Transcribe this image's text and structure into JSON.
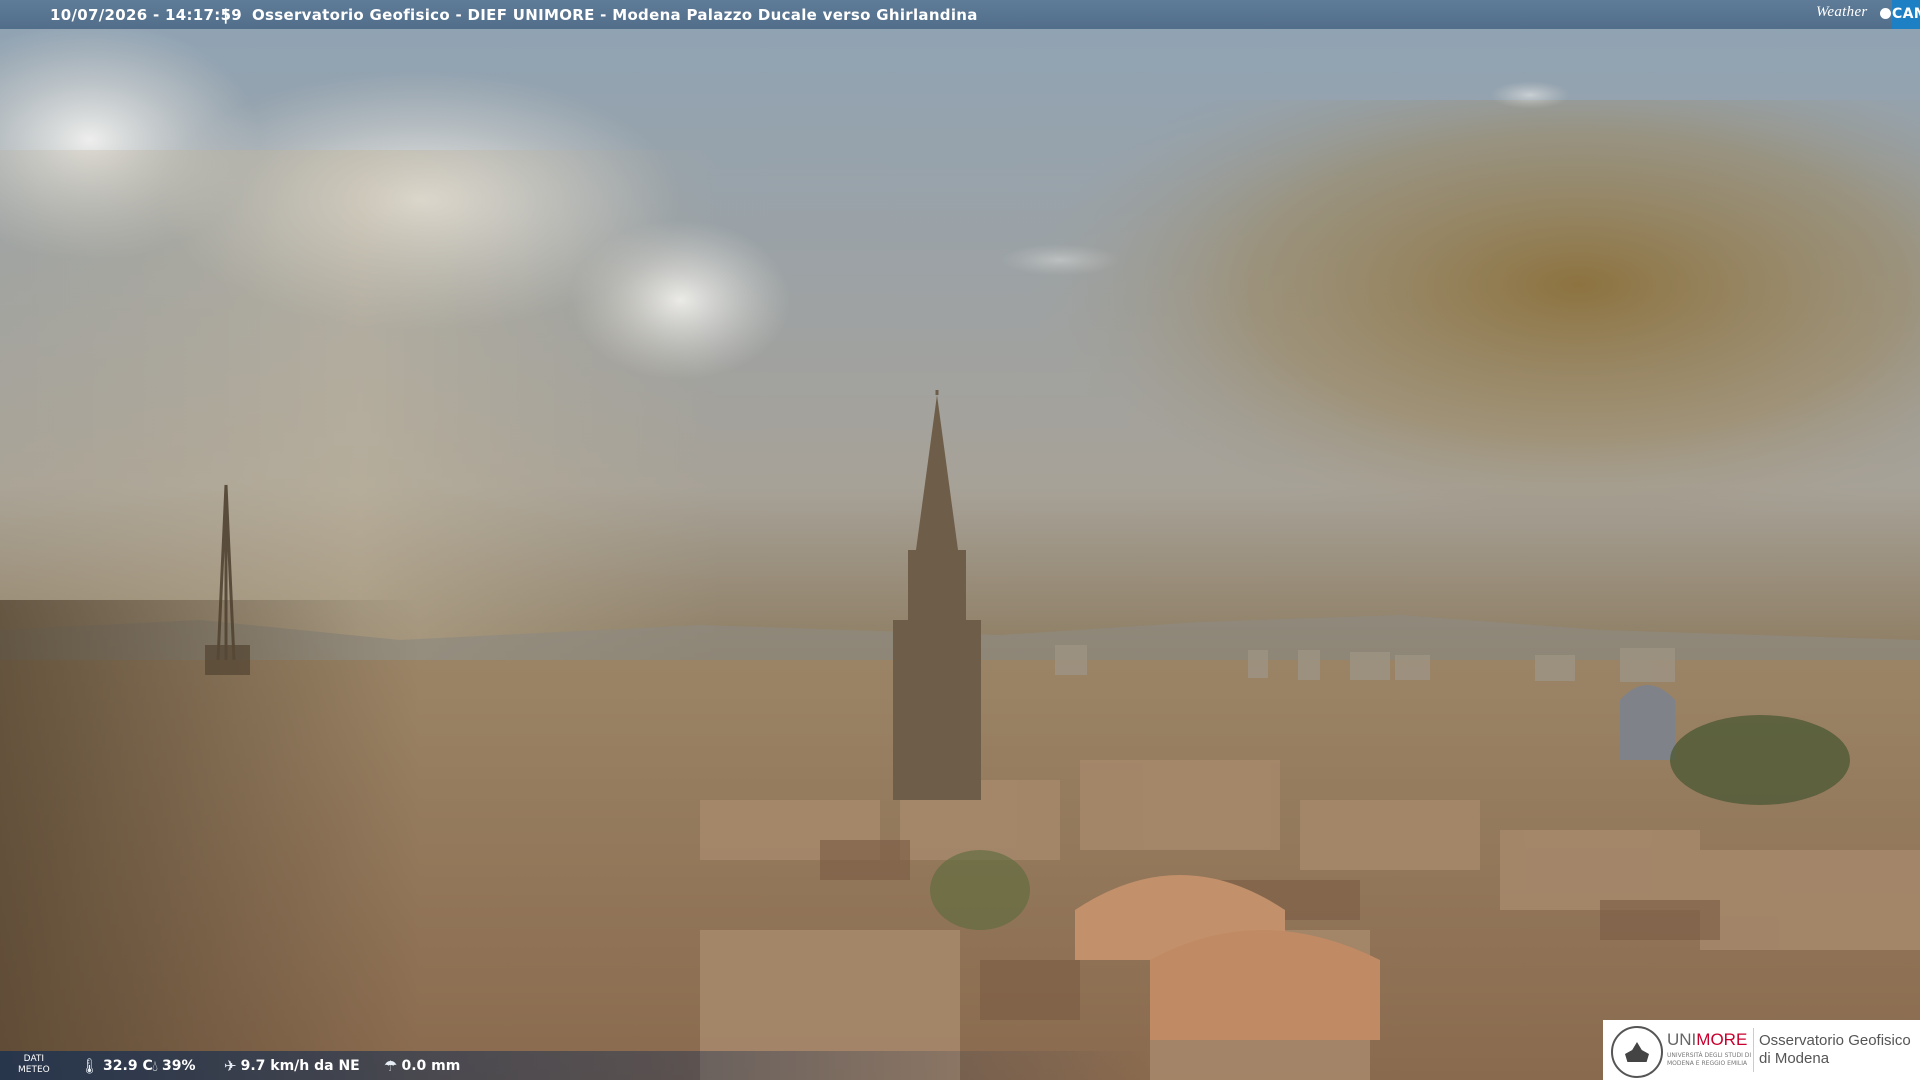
{
  "header": {
    "datetime": "10/07/2026 - 14:17:59",
    "separator": "|",
    "station": "Osservatorio Geofisico - DIEF UNIMORE - Modena Palazzo Ducale verso Ghirlandina",
    "brand_weather": "Weather",
    "brand_cam": "CAM"
  },
  "weather": {
    "label_line1": "DATI",
    "label_line2": "METEO",
    "temperature": "32.9 C",
    "humidity": "39%",
    "wind": "9.7 km/h da NE",
    "rain": "0.0 mm",
    "icons": [
      "thermometer-icon",
      "humidity-drop-icon",
      "wind-icon",
      "rain-umbrella-icon"
    ]
  },
  "logo": {
    "uni_prefix": "UNI",
    "uni_suffix": "MORE",
    "uni_subtitle": "UNIVERSITÀ DEGLI STUDI DI MODENA E REGGIO EMILIA",
    "observatory_line1": "Osservatorio Geofisico",
    "observatory_line2": "di Modena"
  },
  "colors": {
    "header_bg": "#5a7896",
    "cam_blue": "#1d7fc4",
    "unimore_red": "#c8002d"
  }
}
